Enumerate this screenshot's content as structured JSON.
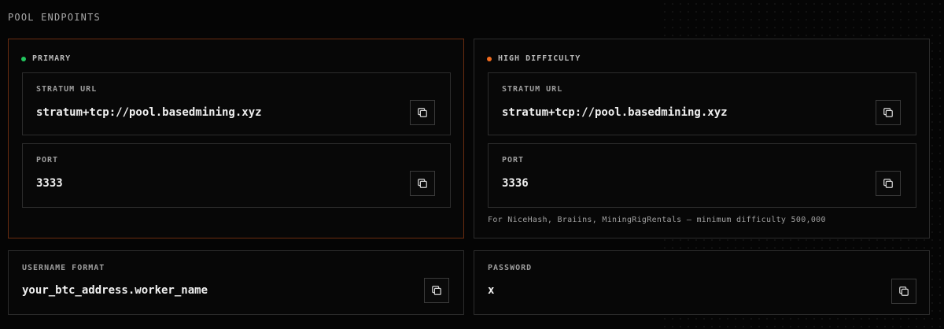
{
  "section": {
    "title": "POOL ENDPOINTS"
  },
  "primary": {
    "header": "PRIMARY",
    "status_color": "#22c55e",
    "url_label": "STRATUM URL",
    "url_value": "stratum+tcp://pool.basedmining.xyz",
    "port_label": "PORT",
    "port_value": "3333"
  },
  "high_difficulty": {
    "header": "HIGH DIFFICULTY",
    "status_color": "#f26b1d",
    "url_label": "STRATUM URL",
    "url_value": "stratum+tcp://pool.basedmining.xyz",
    "port_label": "PORT",
    "port_value": "3336",
    "note": "For NiceHash, Braiins, MiningRigRentals — minimum difficulty 500,000"
  },
  "username": {
    "label": "USERNAME FORMAT",
    "value": "your_btc_address.worker_name"
  },
  "password": {
    "label": "PASSWORD",
    "value": "x"
  },
  "icons": {
    "copy": "copy-icon"
  },
  "colors": {
    "accent": "#f26b1d",
    "active_border": "#6a2c10",
    "background": "#050505"
  }
}
